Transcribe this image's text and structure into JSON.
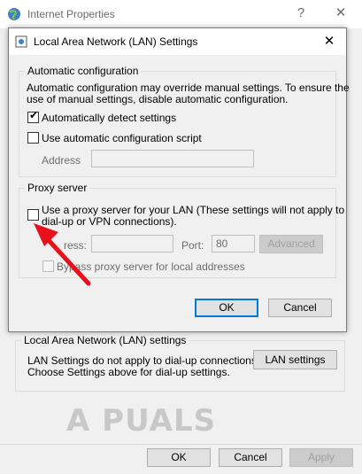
{
  "outer": {
    "title": "Internet Properties",
    "help_glyph": "?",
    "close_glyph": "✕",
    "lan_section": {
      "heading": "Local Area Network (LAN) settings",
      "line1": "LAN Settings do not apply to dial-up connections.",
      "line2": "Choose Settings above for dial-up settings.",
      "button": "LAN settings"
    },
    "watermark": "A PUALS",
    "footer": {
      "ok": "OK",
      "cancel": "Cancel",
      "apply": "Apply"
    }
  },
  "dialog": {
    "title": "Local Area Network (LAN) Settings",
    "close_glyph": "✕",
    "auto_config": {
      "legend": "Automatic configuration",
      "desc1": "Automatic configuration may override manual settings.  To ensure the",
      "desc2": "use of manual settings, disable automatic configuration.",
      "detect_label": "Automatically detect settings",
      "detect_checked": true,
      "script_label": "Use automatic configuration script",
      "script_checked": false,
      "address_label": "Address"
    },
    "proxy": {
      "legend": "Proxy server",
      "use_label1": "Use a proxy server for your LAN (These settings will not apply to",
      "use_label2": "dial-up or VPN connections).",
      "use_checked": false,
      "address_label": "ress:",
      "port_label": "Port:",
      "port_value": "80",
      "advanced": "Advanced",
      "bypass_label": "Bypass proxy server for local addresses"
    },
    "ok": "OK",
    "cancel": "Cancel"
  },
  "annotation_color": "#e8101a"
}
